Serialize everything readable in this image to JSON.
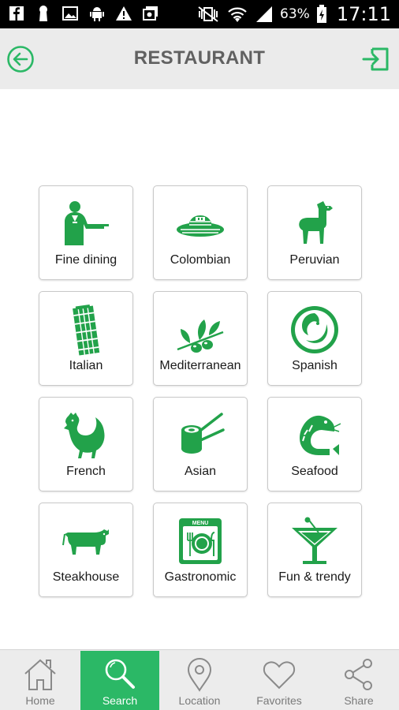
{
  "status_bar": {
    "battery": "63%",
    "time": "17:11",
    "left_icons": [
      "facebook-icon",
      "keyhole-icon",
      "image-icon",
      "android-icon",
      "warning-icon",
      "photos-icon"
    ]
  },
  "header": {
    "title": "RESTAURANT",
    "back_icon": "back-arrow-icon",
    "logout_icon": "logout-icon"
  },
  "categories": [
    {
      "label": "Fine dining",
      "icon": "waiter-icon"
    },
    {
      "label": "Colombian",
      "icon": "sombrero-icon"
    },
    {
      "label": "Peruvian",
      "icon": "llama-icon"
    },
    {
      "label": "Italian",
      "icon": "pisa-tower-icon"
    },
    {
      "label": "Mediterranean",
      "icon": "olive-branch-icon"
    },
    {
      "label": "Spanish",
      "icon": "spanish-emblem-icon"
    },
    {
      "label": "French",
      "icon": "rooster-icon"
    },
    {
      "label": "Asian",
      "icon": "sushi-chopsticks-icon"
    },
    {
      "label": "Seafood",
      "icon": "shrimp-icon"
    },
    {
      "label": "Steakhouse",
      "icon": "cow-icon"
    },
    {
      "label": "Gastronomic",
      "icon": "menu-plate-icon"
    },
    {
      "label": "Fun & trendy",
      "icon": "cocktail-icon"
    }
  ],
  "bottom_nav": [
    {
      "label": "Home",
      "icon": "home-icon",
      "active": false
    },
    {
      "label": "Search",
      "icon": "search-icon",
      "active": true
    },
    {
      "label": "Location",
      "icon": "location-pin-icon",
      "active": false
    },
    {
      "label": "Favorites",
      "icon": "heart-icon",
      "active": false
    },
    {
      "label": "Share",
      "icon": "share-icon",
      "active": false
    }
  ],
  "colors": {
    "accent": "#2bb866",
    "icon_green": "#22a24a",
    "header_bg": "#ebebeb",
    "nav_inactive": "#8a8a8a"
  }
}
